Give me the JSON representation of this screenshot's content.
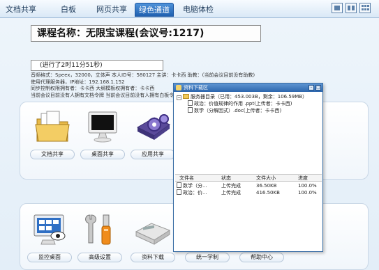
{
  "nav": {
    "tabs": [
      "文档共享",
      "白板",
      "网页共享",
      "绿色通道",
      "电脑体检"
    ],
    "active_index": 3,
    "view_icons": [
      "single-view-icon",
      "split-view-icon",
      "grid-view-icon"
    ]
  },
  "course": {
    "title": "课程名称：无限宝课程(会议号:1217)",
    "elapsed": "(进行了2时11分51秒)"
  },
  "info_lines": [
    "音频格式：Speex，32000，立体声 本人ID号：580127 主讲：卡卡西 助教：(当前会议目前没有助教)",
    "使用代理服务器，IP地址：192.168.1.152",
    "同步控制权限拥有者：卡卡西 大纲模板权拥有者：卡卡西",
    "当前会议目前没有人拥有文档令牌 当前会议目前没有人拥有白板令牌"
  ],
  "apps_top": [
    {
      "icon": "folder-docs-icon",
      "label": "文档共享"
    },
    {
      "icon": "monitor-icon",
      "label": "桌面共享"
    },
    {
      "icon": "gears-icon",
      "label": "应用共享"
    }
  ],
  "apps_bottom": [
    {
      "icon": "monitor-eye-icon",
      "label": "监控桌面"
    },
    {
      "icon": "tools-icon",
      "label": "高级设置"
    },
    {
      "icon": "disk-drive-icon",
      "label": "资料下载"
    },
    {
      "icon": "",
      "label": "统一学制"
    },
    {
      "icon": "",
      "label": "帮助中心"
    }
  ],
  "download": {
    "title": "资料下载区",
    "root": "服务器目录（已用：453.003B，剩余：106.59MB）",
    "files": [
      "政治：价值规律的作用 .ppt(上传者：卡卡西)",
      "数学（分解因式）.doc(上传者：卡卡西)"
    ],
    "columns": [
      "文件名",
      "状态",
      "文件大小",
      "进度"
    ],
    "rows": [
      {
        "name": "数学（分...",
        "status": "上传完成",
        "size": "36.50KB",
        "progress": "100.0%"
      },
      {
        "name": "政治：价...",
        "status": "上传完成",
        "size": "416.50KB",
        "progress": "100.0%"
      }
    ]
  }
}
